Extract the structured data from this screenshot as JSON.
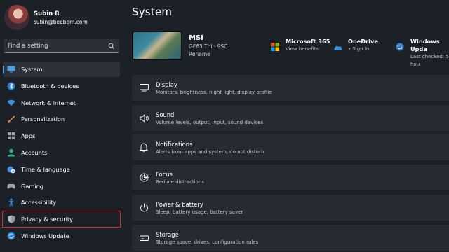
{
  "profile": {
    "name": "Subin B",
    "email": "subin@beebom.com"
  },
  "search": {
    "placeholder": "Find a setting"
  },
  "sidebar": {
    "items": [
      {
        "label": "System",
        "icon": "monitor-icon"
      },
      {
        "label": "Bluetooth & devices",
        "icon": "bluetooth-icon"
      },
      {
        "label": "Network & internet",
        "icon": "wifi-icon"
      },
      {
        "label": "Personalization",
        "icon": "brush-icon"
      },
      {
        "label": "Apps",
        "icon": "apps-icon"
      },
      {
        "label": "Accounts",
        "icon": "person-icon"
      },
      {
        "label": "Time & language",
        "icon": "globe-clock-icon"
      },
      {
        "label": "Gaming",
        "icon": "gamepad-icon"
      },
      {
        "label": "Accessibility",
        "icon": "accessibility-icon"
      },
      {
        "label": "Privacy & security",
        "icon": "shield-icon"
      },
      {
        "label": "Windows Update",
        "icon": "update-icon"
      }
    ]
  },
  "main": {
    "title": "System",
    "device": {
      "name": "MSI",
      "model": "GF63 Thin 9SC",
      "rename": "Rename"
    },
    "quick": [
      {
        "title": "Microsoft 365",
        "sub": "View benefits",
        "icon": "microsoft-logo-icon"
      },
      {
        "title": "OneDrive",
        "sub": "• Sign In",
        "icon": "cloud-icon"
      },
      {
        "title": "Windows Upda",
        "sub": "Last checked: 5 hou",
        "icon": "update-icon"
      }
    ],
    "cards": [
      {
        "title": "Display",
        "sub": "Monitors, brightness, night light, display profile",
        "icon": "display-icon"
      },
      {
        "title": "Sound",
        "sub": "Volume levels, output, input, sound devices",
        "icon": "speaker-icon"
      },
      {
        "title": "Notifications",
        "sub": "Alerts from apps and system, do not disturb",
        "icon": "bell-icon"
      },
      {
        "title": "Focus",
        "sub": "Reduce distractions",
        "icon": "focus-icon"
      },
      {
        "title": "Power & battery",
        "sub": "Sleep, battery usage, battery saver",
        "icon": "power-icon"
      },
      {
        "title": "Storage",
        "sub": "Storage space, drives, configuration rules",
        "icon": "storage-icon"
      }
    ]
  },
  "colors": {
    "accent": "#4ca0e0",
    "highlight_box": "#e02a2a",
    "background": "#1c2027",
    "card": "#262b32"
  }
}
